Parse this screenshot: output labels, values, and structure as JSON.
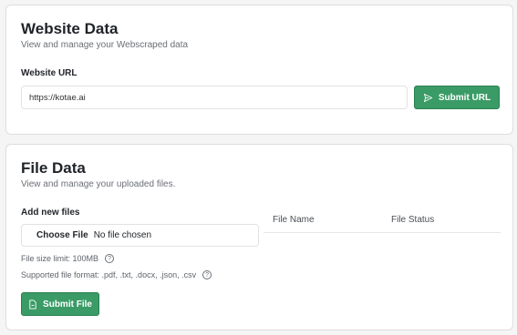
{
  "website": {
    "title": "Website Data",
    "subtitle": "View and manage your Webscraped data",
    "url_label": "Website URL",
    "url_value": "https://kotae.ai",
    "submit_label": "Submit URL"
  },
  "file": {
    "title": "File Data",
    "subtitle": "View and manage your uploaded files.",
    "add_label": "Add new files",
    "choose_label": "Choose File",
    "no_file_text": "No file chosen",
    "size_limit": "File size limit: 100MB",
    "formats": "Supported file format: .pdf, .txt, .docx, .json, .csv",
    "submit_label": "Submit File",
    "table_headers": [
      "File Name",
      "File Status"
    ]
  },
  "colors": {
    "accent": "#3a9b66",
    "background": "#f5f5f5"
  }
}
